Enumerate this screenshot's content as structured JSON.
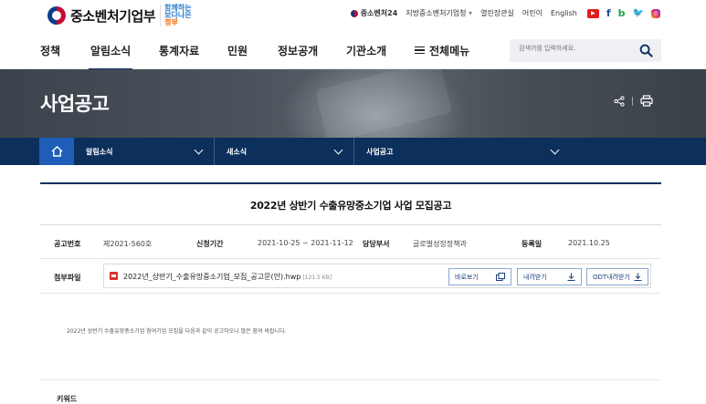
{
  "header": {
    "logo_text": "중소벤처기업부",
    "slogan_line1": "함께하는",
    "slogan_line2": "보다나은",
    "slogan_line3": "정부",
    "util": {
      "site24": "중소벤처24",
      "region_select": "지방중소벤처기업청",
      "links": [
        "열린장관실",
        "어린이",
        "English"
      ]
    },
    "sns": [
      "youtube-icon",
      "facebook-icon",
      "blog-icon",
      "twitter-icon",
      "instagram-icon"
    ]
  },
  "gnb": {
    "items": [
      "정책",
      "알림소식",
      "통계자료",
      "민원",
      "정보공개",
      "기관소개"
    ],
    "active": "알림소식",
    "all_menu": "전체메뉴",
    "search_placeholder": "검색어를 입력하세요."
  },
  "banner": {
    "title": "사업공고"
  },
  "location": {
    "items": [
      "알림소식",
      "새소식",
      "사업공고"
    ]
  },
  "article": {
    "title": "2022년 상반기 수출유망중소기업 사업 모집공고",
    "labels": {
      "notice_no": "공고번호",
      "period": "신청기간",
      "dept": "담당부서",
      "reg_date": "등록일",
      "attachment": "첨부파일"
    },
    "notice_no": "제2021-560호",
    "period": "2021-10-25 ~ 2021-11-12",
    "dept": "글로벌성장정책과",
    "reg_date": "2021.10.25",
    "attachment": {
      "name": "2022년_상반기_수출유망중소기업_모집_공고문(안).hwp",
      "size": "[121.5 KB]",
      "buttons": [
        "바로보기",
        "내려받기",
        "ODT내려받기"
      ]
    },
    "body": "2022년 상반기 수출유망중소기업 참여기업 모집을 다음과 같이 공고하오니 많은 참여 바랍니다.",
    "keyword_label": "키워드"
  },
  "colors": {
    "navy": "#0c2f5c",
    "home_blue": "#1f5eb8",
    "file_red": "#d8312c"
  }
}
